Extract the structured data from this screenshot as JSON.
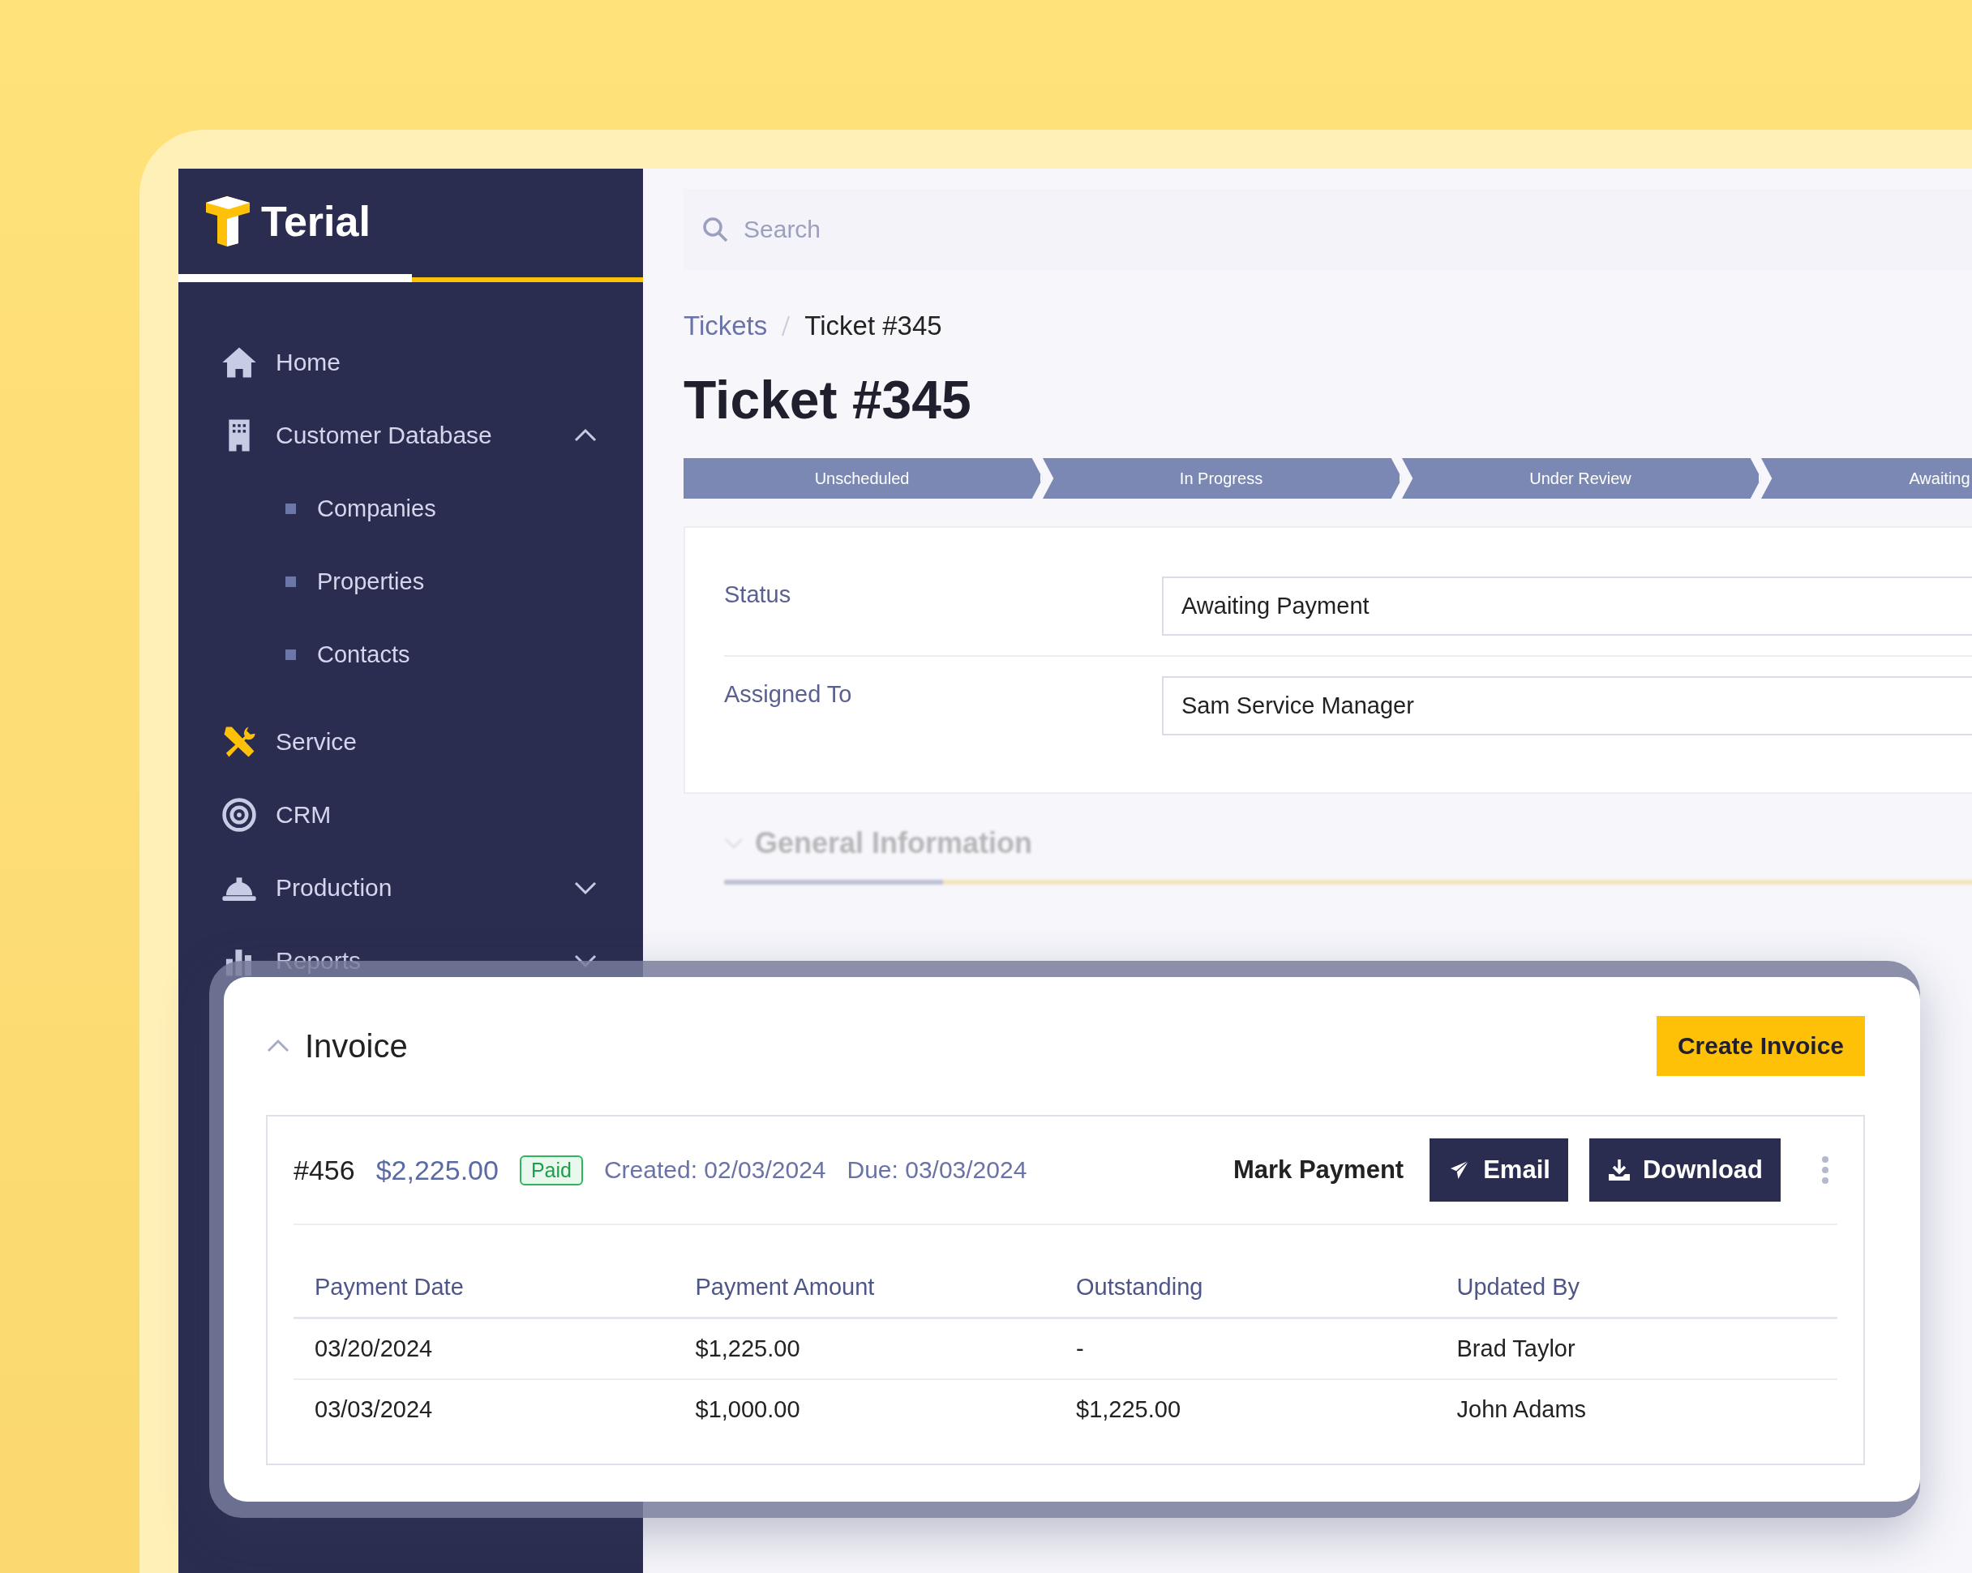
{
  "brand": {
    "name": "Terial"
  },
  "sidebar": {
    "items": [
      {
        "label": "Home"
      },
      {
        "label": "Customer Database",
        "expanded": true,
        "children": [
          {
            "label": "Companies"
          },
          {
            "label": "Properties"
          },
          {
            "label": "Contacts"
          }
        ]
      },
      {
        "label": "Service"
      },
      {
        "label": "CRM"
      },
      {
        "label": "Production",
        "expanded": false
      },
      {
        "label": "Reports",
        "expanded": false
      }
    ]
  },
  "search": {
    "placeholder": "Search"
  },
  "breadcrumb": [
    "Tickets",
    "Ticket #345"
  ],
  "title": "Ticket #345",
  "pipeline": [
    "Unscheduled",
    "In Progress",
    "Under Review",
    "Awaiting"
  ],
  "fields": [
    {
      "label": "Status",
      "value": "Awaiting Payment"
    },
    {
      "label": "Assigned To",
      "value": "Sam Service Manager"
    }
  ],
  "general_section": {
    "title": "General Information",
    "expanded": false
  },
  "invoice": {
    "title": "Invoice",
    "expanded": true,
    "create_button": "Create Invoice",
    "number": "#456",
    "amount": "$2,225.00",
    "badge": "Paid",
    "created": "Created: 02/03/2024",
    "due": "Due: 03/03/2024",
    "actions": {
      "mark": "Mark Payment",
      "email": "Email",
      "download": "Download"
    },
    "columns": [
      "Payment Date",
      "Payment Amount",
      "Outstanding",
      "Updated By"
    ],
    "rows": [
      [
        "03/20/2024",
        "$1,225.00",
        "-",
        "Brad Taylor"
      ],
      [
        "03/03/2024",
        "$1,000.00",
        "$1,225.00",
        "John Adams"
      ]
    ]
  }
}
